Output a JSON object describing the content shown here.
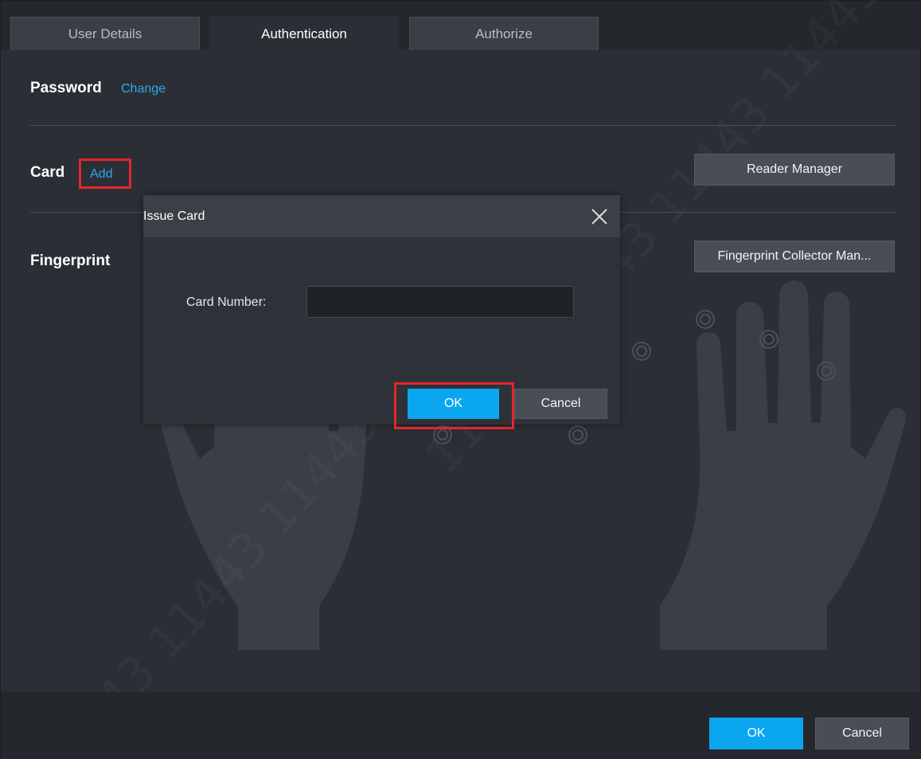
{
  "tabs": [
    {
      "label": "User Details"
    },
    {
      "label": "Authentication"
    },
    {
      "label": "Authorize"
    }
  ],
  "password": {
    "title": "Password",
    "link": "Change"
  },
  "card": {
    "title": "Card",
    "link": "Add",
    "reader_button": "Reader Manager"
  },
  "fingerprint": {
    "title": "Fingerprint",
    "collector_button": "Fingerprint Collector Man..."
  },
  "dialog": {
    "title": "Issue Card",
    "card_number_label": "Card Number:",
    "card_number_value": "",
    "ok_label": "OK",
    "cancel_label": "Cancel"
  },
  "footer": {
    "ok_label": "OK",
    "cancel_label": "Cancel"
  },
  "watermark": {
    "text": "11443 11443 11443 11443"
  },
  "colors": {
    "accent": "#0aa6f0",
    "link": "#2fa8f0",
    "highlight": "#e3262c",
    "background": "#2b2f35"
  }
}
